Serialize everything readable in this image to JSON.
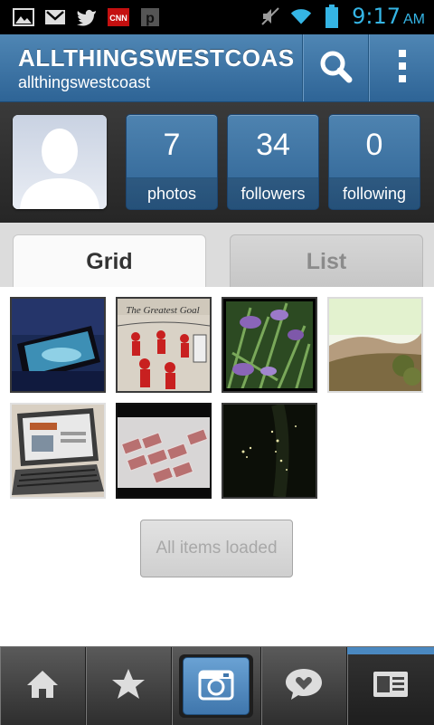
{
  "status_bar": {
    "time": "9:17",
    "ampm": "AM",
    "icons": [
      "gallery-icon",
      "gmail-icon",
      "twitter-icon",
      "cnn-icon",
      "p-icon",
      "mute-icon",
      "wifi-icon",
      "battery-icon"
    ],
    "cnn_label": "CNN",
    "p_label": "p"
  },
  "header": {
    "title": "ALLTHINGSWESTCOAS",
    "subtitle": "allthingswestcoast"
  },
  "profile": {
    "stats": [
      {
        "value": "7",
        "label": "photos"
      },
      {
        "value": "34",
        "label": "followers"
      },
      {
        "value": "0",
        "label": "following"
      }
    ]
  },
  "tabs": [
    {
      "label": "Grid",
      "active": true
    },
    {
      "label": "List",
      "active": false
    }
  ],
  "photos": [
    {
      "name": "photo-tablet"
    },
    {
      "name": "photo-hockey",
      "caption": "The Greatest Goal"
    },
    {
      "name": "photo-lavender"
    },
    {
      "name": "photo-hills"
    },
    {
      "name": "photo-laptop"
    },
    {
      "name": "photo-tiles"
    },
    {
      "name": "photo-night"
    }
  ],
  "load_status": "All items loaded",
  "nav": {
    "items": [
      "home-icon",
      "star-icon",
      "camera-icon",
      "heart-speech-icon",
      "profile-card-icon"
    ],
    "active": "profile-card-icon"
  },
  "colors": {
    "header_blue": "#3f75a6",
    "status_time": "#35b5e5"
  }
}
